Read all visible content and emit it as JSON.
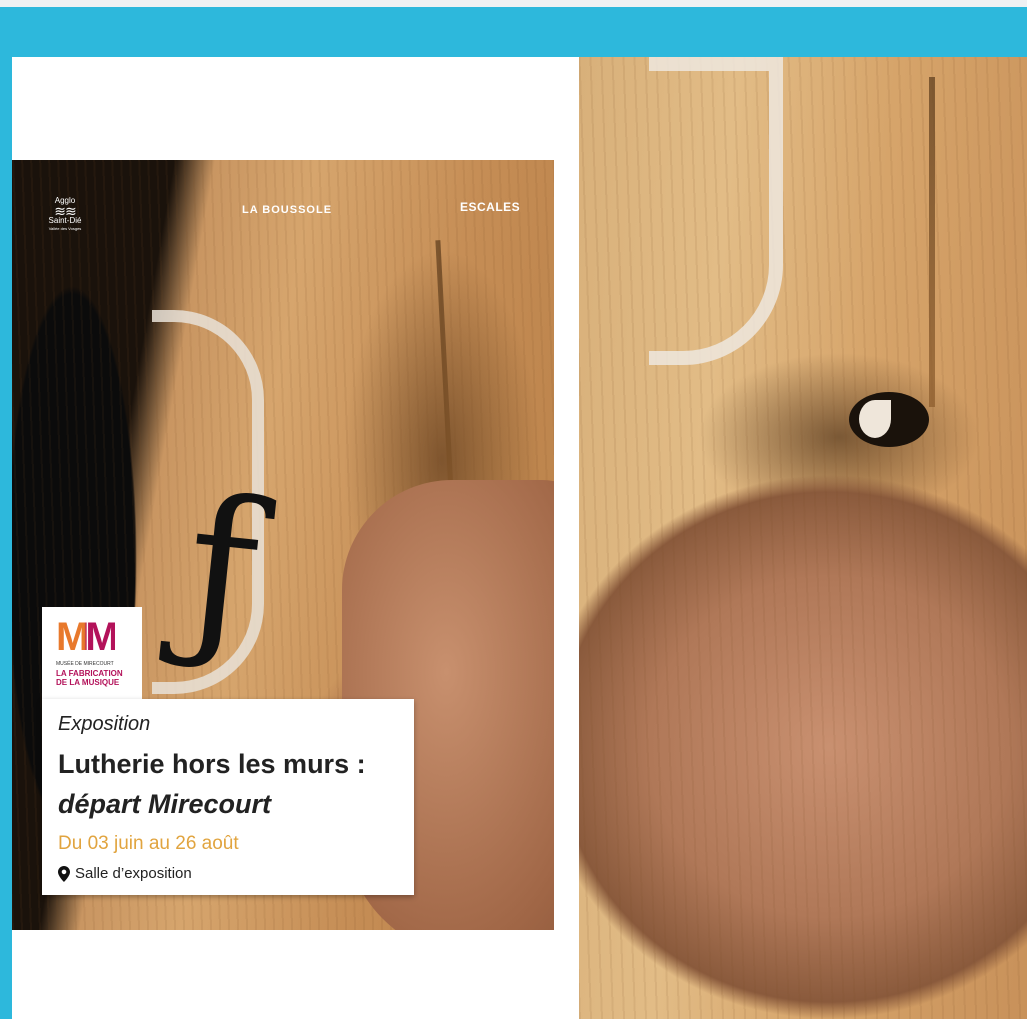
{
  "poster": {
    "logos": {
      "agglo_line1": "Agglo",
      "agglo_waves": "≋≋",
      "agglo_line2": "Saint-Dié",
      "agglo_line3": "Vallée des Vosges",
      "boussole": "LA BOUSSOLE",
      "escales": "ESCALES"
    },
    "badge": {
      "mm": "MM",
      "museum_line": "MUSÉE DE MIRECOURT",
      "brand_line1": "LA FABRICATION",
      "brand_line2": "DE LA MUSIQUE"
    },
    "card": {
      "kicker": "Exposition",
      "title_line1": "Lutherie hors les murs :",
      "title_line2": "départ Mirecourt",
      "dates": "Du 03 juin au 26 août",
      "place": "Salle d’exposition"
    }
  },
  "colors": {
    "topbar": "#2db8dc",
    "dates": "#e1a43f",
    "mm_orange": "#e8792c",
    "mm_magenta": "#b3125a"
  },
  "icons": {
    "place": "map-pin-icon"
  }
}
